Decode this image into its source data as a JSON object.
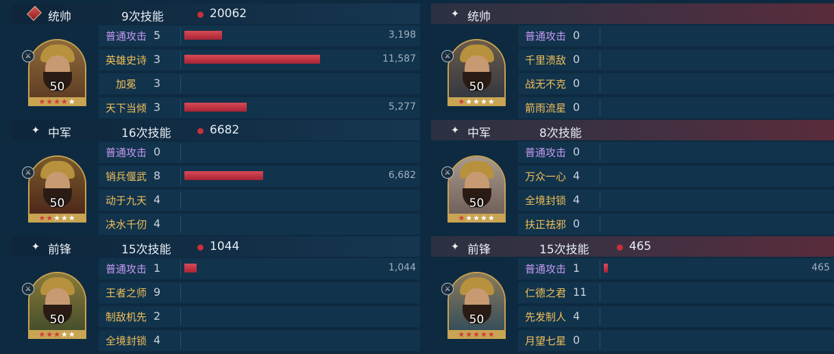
{
  "left": {
    "sections": [
      {
        "role": "统帅",
        "skill_count": "9次技能",
        "damage": "20062",
        "level": "50",
        "stars_red": 4,
        "stars_total": 5,
        "skills": [
          {
            "name": "普通攻击",
            "count": "5",
            "value": "3,198",
            "fraction": 0.28
          },
          {
            "name": "英雄史诗",
            "count": "3",
            "value": "11,587",
            "fraction": 1.0
          },
          {
            "name": "加冕",
            "count": "3",
            "value": "",
            "fraction": 0
          },
          {
            "name": "天下当倾",
            "count": "3",
            "value": "5,277",
            "fraction": 0.46
          }
        ]
      },
      {
        "role": "中军",
        "skill_count": "16次技能",
        "damage": "6682",
        "level": "50",
        "stars_red": 2,
        "stars_total": 5,
        "skills": [
          {
            "name": "普通攻击",
            "count": "0",
            "value": "",
            "fraction": 0
          },
          {
            "name": "销兵偃武",
            "count": "8",
            "value": "6,682",
            "fraction": 0.58
          },
          {
            "name": "动于九天",
            "count": "4",
            "value": "",
            "fraction": 0
          },
          {
            "name": "决水千仞",
            "count": "4",
            "value": "",
            "fraction": 0
          }
        ]
      },
      {
        "role": "前锋",
        "skill_count": "15次技能",
        "damage": "1044",
        "level": "50",
        "stars_red": 3,
        "stars_total": 5,
        "skills": [
          {
            "name": "普通攻击",
            "count": "1",
            "value": "1,044",
            "fraction": 0.09
          },
          {
            "name": "王者之师",
            "count": "9",
            "value": "",
            "fraction": 0
          },
          {
            "name": "制敌机先",
            "count": "2",
            "value": "",
            "fraction": 0
          },
          {
            "name": "全境封锁",
            "count": "4",
            "value": "",
            "fraction": 0
          }
        ]
      }
    ]
  },
  "right": {
    "sections": [
      {
        "role": "统帅",
        "skill_count": "",
        "damage": "",
        "level": "50",
        "stars_red": 1,
        "stars_total": 5,
        "skills": [
          {
            "name": "普通攻击",
            "count": "0",
            "value": "",
            "fraction": 0
          },
          {
            "name": "千里溃敌",
            "count": "0",
            "value": "",
            "fraction": 0
          },
          {
            "name": "战无不克",
            "count": "0",
            "value": "",
            "fraction": 0
          },
          {
            "name": "箭雨流星",
            "count": "0",
            "value": "",
            "fraction": 0
          }
        ]
      },
      {
        "role": "中军",
        "skill_count": "8次技能",
        "damage": "",
        "level": "50",
        "stars_red": 1,
        "stars_total": 5,
        "skills": [
          {
            "name": "普通攻击",
            "count": "0",
            "value": "",
            "fraction": 0
          },
          {
            "name": "万众一心",
            "count": "4",
            "value": "",
            "fraction": 0
          },
          {
            "name": "全境封锁",
            "count": "4",
            "value": "",
            "fraction": 0
          },
          {
            "name": "扶正祛邪",
            "count": "0",
            "value": "",
            "fraction": 0
          }
        ]
      },
      {
        "role": "前锋",
        "skill_count": "15次技能",
        "damage": "465",
        "level": "50",
        "stars_red": 5,
        "stars_total": 5,
        "skills": [
          {
            "name": "普通攻击",
            "count": "1",
            "value": "465",
            "fraction": 0.025
          },
          {
            "name": "仁德之君",
            "count": "11",
            "value": "",
            "fraction": 0
          },
          {
            "name": "先发制人",
            "count": "4",
            "value": "",
            "fraction": 0
          },
          {
            "name": "月望七星",
            "count": "0",
            "value": "",
            "fraction": 0
          }
        ]
      }
    ]
  },
  "colors": {
    "bar": "#c8303d",
    "skill_gold": "#f0c05a",
    "skill_purple": "#c39af0",
    "right_header_accent": "#5a2c3c"
  }
}
